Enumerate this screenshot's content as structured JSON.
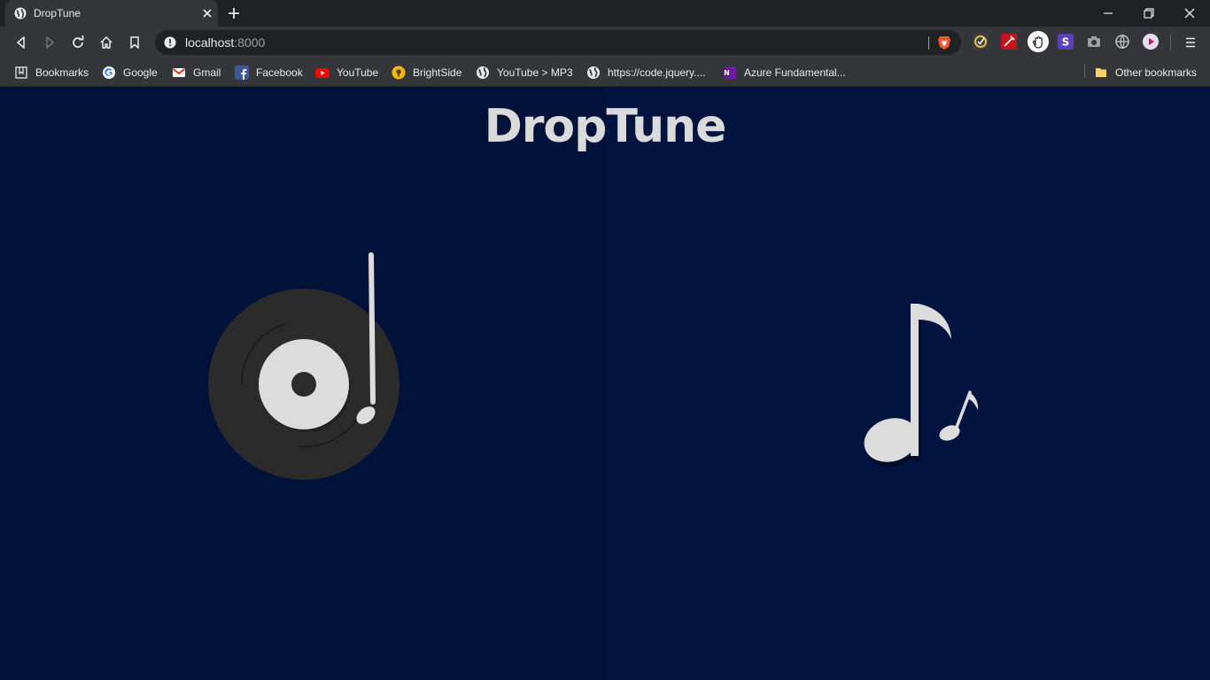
{
  "browser": {
    "tab": {
      "title": "DropTune",
      "favicon": "globe-icon"
    },
    "address": {
      "host": "localhost",
      "port": ":8000"
    },
    "toolbar_icons": [
      "back-icon",
      "forward-icon",
      "reload-icon",
      "home-icon",
      "bookmark-icon"
    ],
    "extensions": [
      "extension-1-icon",
      "extension-2-icon",
      "extension-3-icon",
      "extension-4-icon",
      "camera-icon",
      "globe-icon",
      "extension-7-icon"
    ],
    "bookmarks": [
      {
        "label": "Bookmarks",
        "icon": "bookmarks-panel-icon"
      },
      {
        "label": "Google",
        "icon": "google-icon"
      },
      {
        "label": "Gmail",
        "icon": "gmail-icon"
      },
      {
        "label": "Facebook",
        "icon": "facebook-icon"
      },
      {
        "label": "YouTube",
        "icon": "youtube-icon"
      },
      {
        "label": "BrightSide",
        "icon": "brightside-icon"
      },
      {
        "label": "YouTube > MP3",
        "icon": "globe-icon"
      },
      {
        "label": "https://code.jquery....",
        "icon": "globe-icon"
      },
      {
        "label": "Azure Fundamental...",
        "icon": "onenote-icon"
      }
    ],
    "other_bookmarks": {
      "label": "Other bookmarks",
      "icon": "folder-icon"
    }
  },
  "page": {
    "logo": "DropTune",
    "left_art": "vinyl-record-icon",
    "right_art": "music-notes-icon"
  },
  "colors": {
    "page_left": "#00123a",
    "page_right": "#01143f",
    "logo": "#dadada",
    "art_light": "#dcdcdc",
    "record_dark": "#2b2b2b"
  }
}
